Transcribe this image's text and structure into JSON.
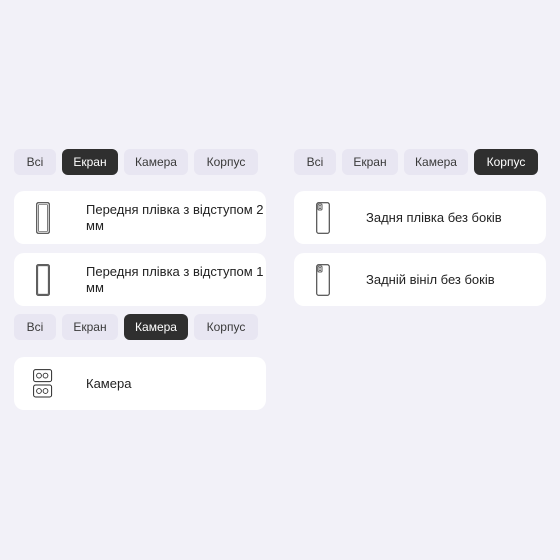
{
  "left_panel": {
    "tabs": [
      {
        "label": "Всі",
        "active": false
      },
      {
        "label": "Екран",
        "active": true
      },
      {
        "label": "Камера",
        "active": false
      },
      {
        "label": "Корпус",
        "active": false
      }
    ],
    "items": [
      {
        "label": "Передня плівка з відступом 2 мм",
        "icon": "phone-front-icon"
      },
      {
        "label": "Передня плівка з відступом 1 мм",
        "icon": "phone-front-icon"
      }
    ]
  },
  "right_panel": {
    "tabs": [
      {
        "label": "Всі",
        "active": false
      },
      {
        "label": "Екран",
        "active": false
      },
      {
        "label": "Камера",
        "active": false
      },
      {
        "label": "Корпус",
        "active": true
      }
    ],
    "items": [
      {
        "label": "Задня плівка без боків",
        "icon": "phone-back-icon"
      },
      {
        "label": "Задній вініл без боків",
        "icon": "phone-back-icon"
      }
    ]
  },
  "camera_panel": {
    "tabs": [
      {
        "label": "Всі",
        "active": false
      },
      {
        "label": "Екран",
        "active": false
      },
      {
        "label": "Камера",
        "active": true
      },
      {
        "label": "Корпус",
        "active": false
      }
    ],
    "items": [
      {
        "label": "Камера",
        "icon": "camera-module-icon"
      }
    ]
  }
}
